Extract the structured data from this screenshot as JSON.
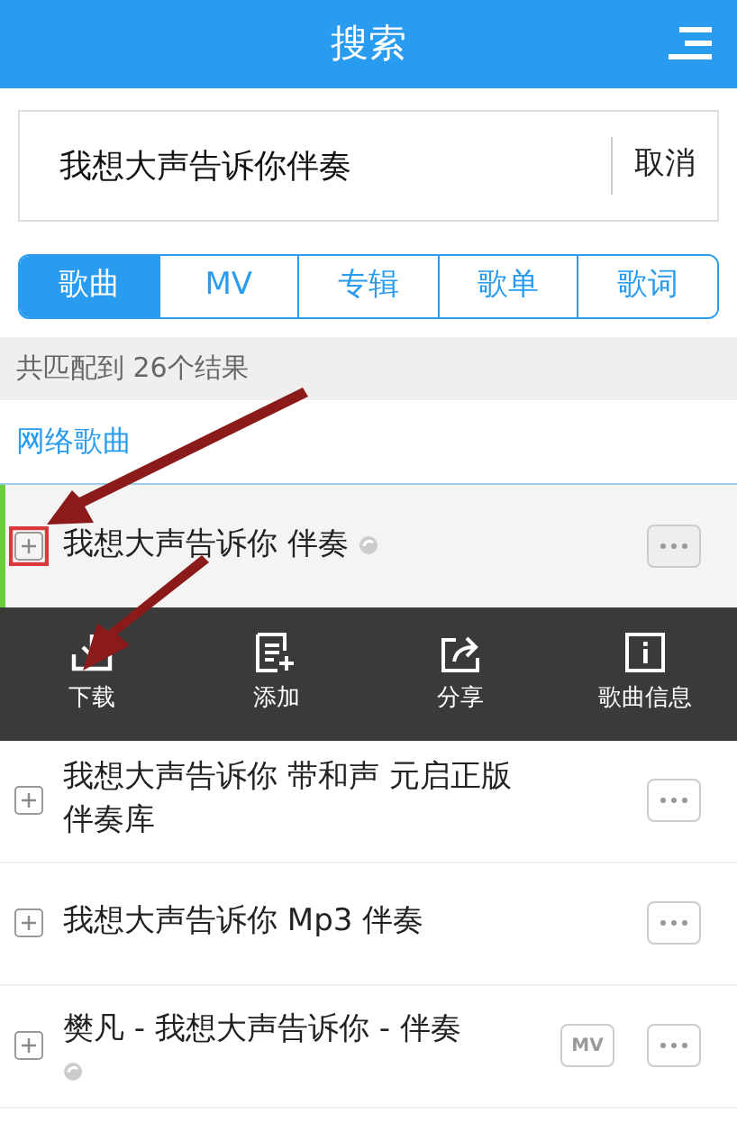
{
  "header": {
    "title": "搜索"
  },
  "search": {
    "value": "我想大声告诉你伴奏",
    "cancel": "取消"
  },
  "tabs": [
    {
      "label": "歌曲",
      "selected": true
    },
    {
      "label": "MV",
      "selected": false
    },
    {
      "label": "专辑",
      "selected": false
    },
    {
      "label": "歌单",
      "selected": false
    },
    {
      "label": "歌词",
      "selected": false
    }
  ],
  "result_count": "共匹配到 26个结果",
  "section_title": "网络歌曲",
  "songs": [
    {
      "title": "我想大声告诉你 伴奏",
      "expanded": true,
      "current": true,
      "highlighted": true,
      "source_icon": true
    },
    {
      "title": "我想大声告诉你 带和声 元启正版伴奏库",
      "expanded": false,
      "current": false,
      "highlighted": false,
      "source_icon": false
    },
    {
      "title": "我想大声告诉你 Mp3 伴奏",
      "expanded": false,
      "current": false,
      "highlighted": false,
      "source_icon": false
    },
    {
      "title": "樊凡 - 我想大声告诉你 - 伴奏",
      "expanded": false,
      "current": false,
      "highlighted": false,
      "source_icon": true,
      "mv": "MV"
    }
  ],
  "actions": [
    {
      "kind": "download",
      "label": "下载"
    },
    {
      "kind": "add",
      "label": "添加"
    },
    {
      "kind": "share",
      "label": "分享"
    },
    {
      "kind": "info",
      "label": "歌曲信息"
    }
  ]
}
